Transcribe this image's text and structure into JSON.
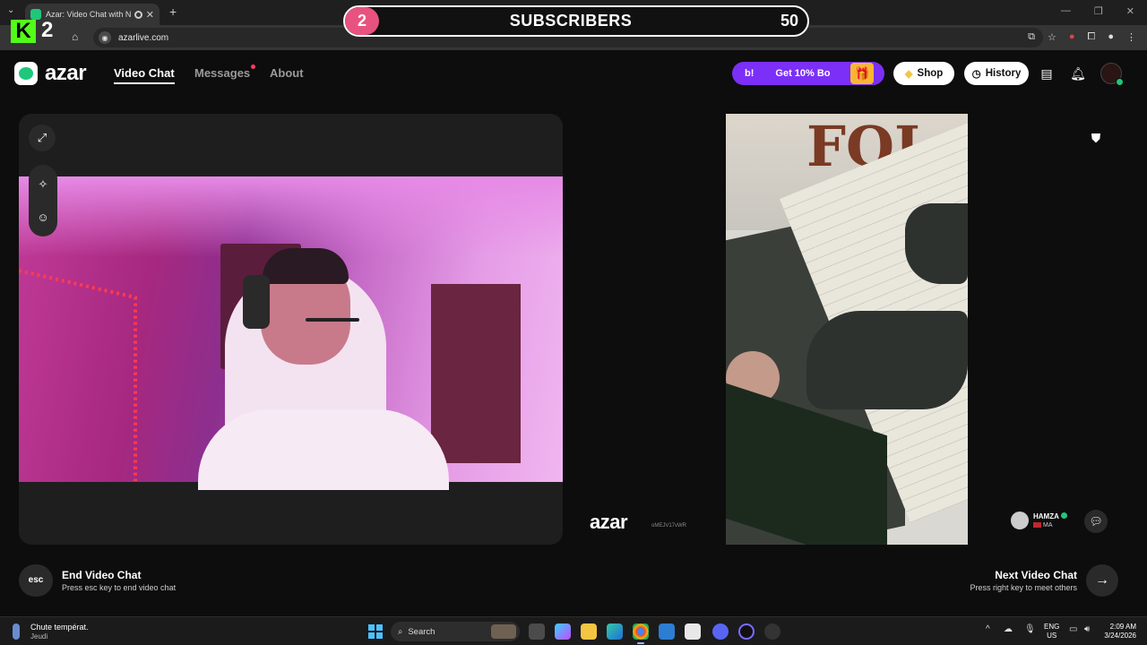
{
  "browser": {
    "tab_title": "Azar: Video Chat with New",
    "url": "azarlive.com"
  },
  "overlay": {
    "kick_count": "2",
    "sub_current": "2",
    "sub_label": "SUBSCRIBERS",
    "sub_goal": "50"
  },
  "header": {
    "logo_text": "azar",
    "nav": [
      {
        "label": "Video Chat",
        "active": true
      },
      {
        "label": "Messages",
        "has_dot": true
      },
      {
        "label": "About"
      }
    ],
    "promo_left": "b!",
    "promo_text": "Get 10% Bo",
    "shop_label": "Shop",
    "history_label": "History"
  },
  "partner": {
    "watermark": "azar",
    "watermark_id": "oMEJV17vWR",
    "name": "HAMZA",
    "country": "MA"
  },
  "controls": {
    "esc_label": "esc",
    "end_title": "End Video Chat",
    "end_sub": "Press esc key to end video chat",
    "next_title": "Next Video Chat",
    "next_sub": "Press right key to meet others"
  },
  "taskbar": {
    "weather_line1": "Chute températ.",
    "weather_line2": "Jeudi",
    "search_placeholder": "Search",
    "lang_line1": "ENG",
    "lang_line2": "US",
    "time": "2:09 AM",
    "date": "3/24/2026"
  },
  "colors": {
    "accent_green": "#1ec77b",
    "promo_purple": "#7b2ff7",
    "sub_pink": "#e8527f",
    "kick_green": "#53fc18"
  }
}
